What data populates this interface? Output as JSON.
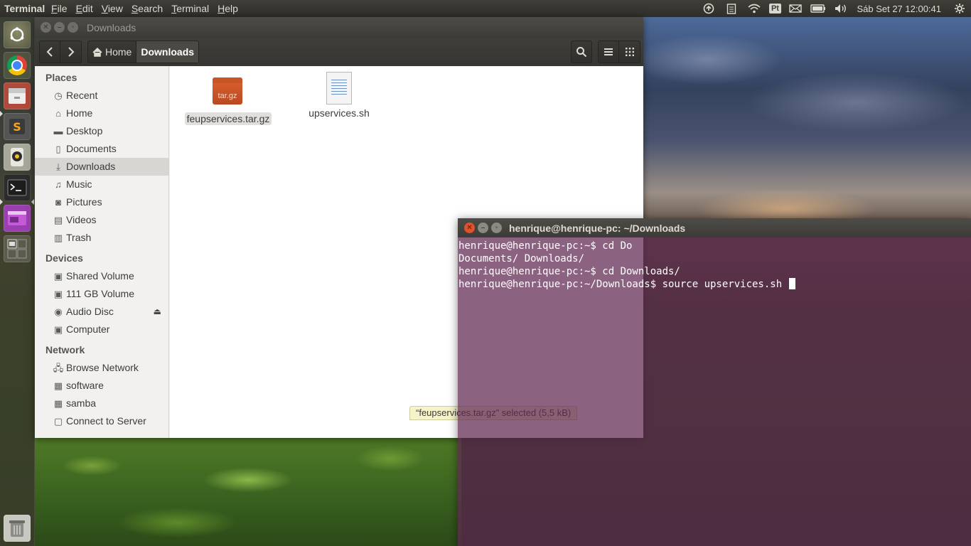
{
  "top_panel": {
    "app_name": "Terminal",
    "menus": [
      {
        "first": "F",
        "rest": "ile"
      },
      {
        "first": "E",
        "rest": "dit"
      },
      {
        "first": "V",
        "rest": "iew"
      },
      {
        "first": "S",
        "rest": "earch"
      },
      {
        "first": "T",
        "rest": "erminal"
      },
      {
        "first": "H",
        "rest": "elp"
      }
    ],
    "keyboard_layout": "Pt",
    "clock": "Sáb Set 27 12:00:41"
  },
  "launcher": {
    "icons": [
      "dash-home-icon",
      "chrome-icon",
      "files-icon",
      "sublime-text-icon",
      "rhythmbox-icon",
      "terminal-icon",
      "app-icon",
      "workspace-switcher-icon",
      "trash-icon"
    ]
  },
  "nautilus": {
    "title": "Downloads",
    "breadcrumb": {
      "home": "Home",
      "current": "Downloads"
    },
    "sidebar": {
      "places_heading": "Places",
      "places": [
        "Recent",
        "Home",
        "Desktop",
        "Documents",
        "Downloads",
        "Music",
        "Pictures",
        "Videos",
        "Trash"
      ],
      "devices_heading": "Devices",
      "devices": [
        "Shared Volume",
        "111 GB Volume",
        "Audio Disc",
        "Computer"
      ],
      "network_heading": "Network",
      "network": [
        "Browse Network",
        "software",
        "samba",
        "Connect to Server"
      ]
    },
    "files": [
      {
        "name": "feupservices.tar.gz",
        "icon_text": "tar.gz"
      },
      {
        "name": "upservices.sh"
      }
    ],
    "status": "“feupservices.tar.gz” selected  (5,5 kB)"
  },
  "terminal": {
    "title": "henrique@henrique-pc: ~/Downloads",
    "lines": [
      "henrique@henrique-pc:~$ cd Do",
      "Documents/ Downloads/",
      "henrique@henrique-pc:~$ cd Downloads/",
      "henrique@henrique-pc:~/Downloads$ source upservices.sh "
    ]
  }
}
